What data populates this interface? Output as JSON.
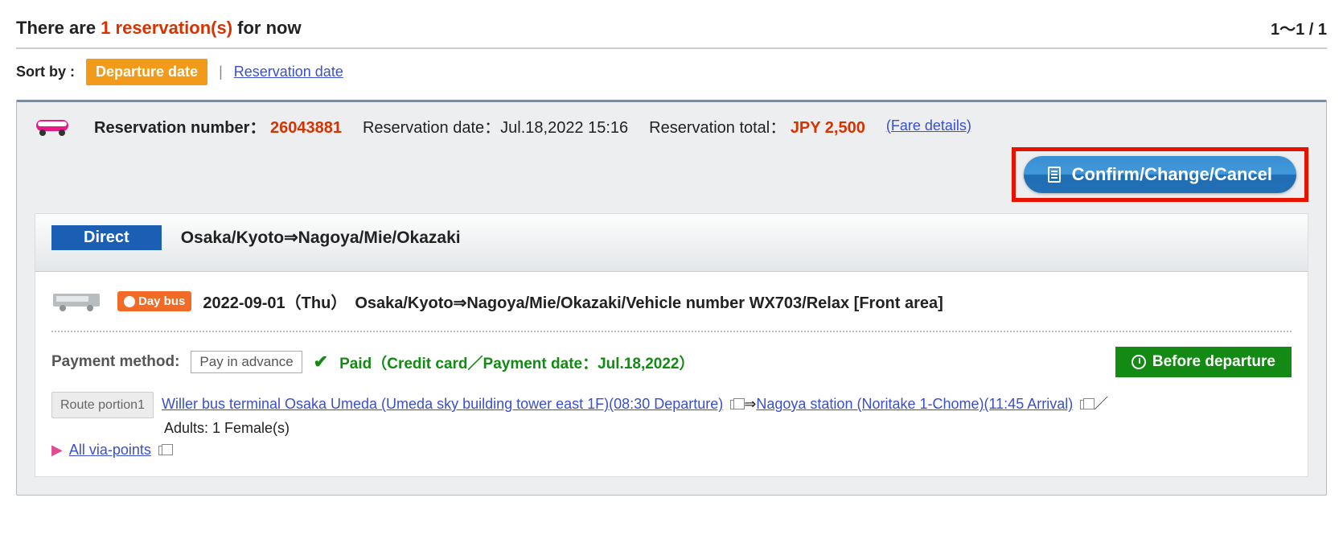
{
  "header": {
    "prefix": "There are ",
    "count": "1 reservation(s)",
    "suffix": " for now",
    "pager": "1～1 / 1"
  },
  "sort": {
    "label": "Sort by :",
    "active": "Departure date",
    "alt": "Reservation date"
  },
  "reservation": {
    "meta": {
      "num_label": "Reservation number：",
      "num": "26043881",
      "date_label": "Reservation date：",
      "date": "Jul.18,2022 15:16",
      "total_label": "Reservation total：",
      "total": "JPY 2,500",
      "fare_link": "(Fare details)"
    },
    "action_btn": "Confirm/Change/Cancel",
    "trip": {
      "direct_badge": "Direct",
      "route_title": "Osaka/Kyoto⇒Nagoya/Mie/Okazaki",
      "daybus": "Day bus",
      "schedule": "2022-09-01（Thu）　Osaka/Kyoto⇒Nagoya/Mie/Okazaki/Vehicle number WX703/Relax [Front area]",
      "pay_label": "Payment method:",
      "pay_method": "Pay in advance",
      "paid_text": "Paid（Credit card／Payment date：Jul.18,2022）",
      "status": "Before departure",
      "portion_badge": "Route portion1",
      "dep_link": "Willer bus terminal Osaka Umeda (Umeda sky building tower east 1F)(08:30 Departure)",
      "arrow": "⇒",
      "arr_link": "Nagoya station (Noritake 1-Chome)(11:45 Arrival)",
      "slash": "／",
      "pax": "Adults: 1 Female(s)",
      "via": "All via-points"
    }
  }
}
